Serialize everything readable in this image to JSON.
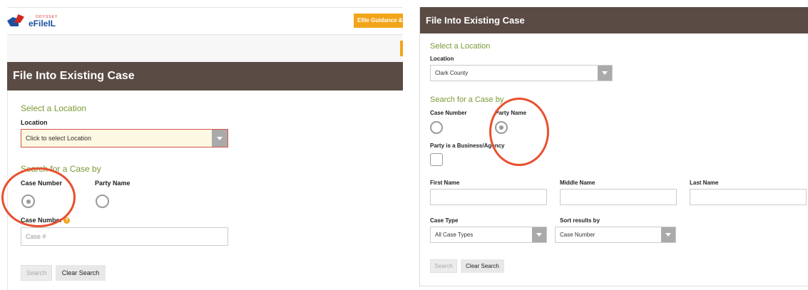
{
  "left": {
    "logo": {
      "small_text": "ODYSSEY",
      "brand": "eFileIL"
    },
    "guidance_button": "Efile Guidance &",
    "header_title": "File Into Existing Case",
    "select_location_title": "Select a Location",
    "location_label": "Location",
    "location_value": "Click to select Location",
    "search_title": "Search for a Case by",
    "radio_case_number": "Case Number",
    "radio_party_name": "Party Name",
    "case_number_label": "Case Number",
    "case_number_placeholder": "Case #",
    "search_button": "Search",
    "clear_button": "Clear Search"
  },
  "right": {
    "header_title": "File Into Existing Case",
    "select_location_title": "Select a Location",
    "location_label": "Location",
    "location_value": "Clark County",
    "search_title": "Search for a Case by",
    "radio_case_number": "Case Number",
    "radio_party_name": "Party Name",
    "business_label": "Party is a Business/Agency",
    "first_name_label": "First Name",
    "middle_name_label": "Middle Name",
    "last_name_label": "Last Name",
    "case_type_label": "Case Type",
    "case_type_value": "All Case Types",
    "sort_label": "Sort results by",
    "sort_value": "Case Number",
    "search_button": "Search",
    "clear_button": "Clear Search"
  },
  "colors": {
    "header_bg": "#5a4b45",
    "section_title": "#7a9a35",
    "guidance_orange": "#f2a51a",
    "highlight_circle": "#e8502f",
    "required_border": "#d9534f",
    "required_bg": "#fdf8e1"
  }
}
